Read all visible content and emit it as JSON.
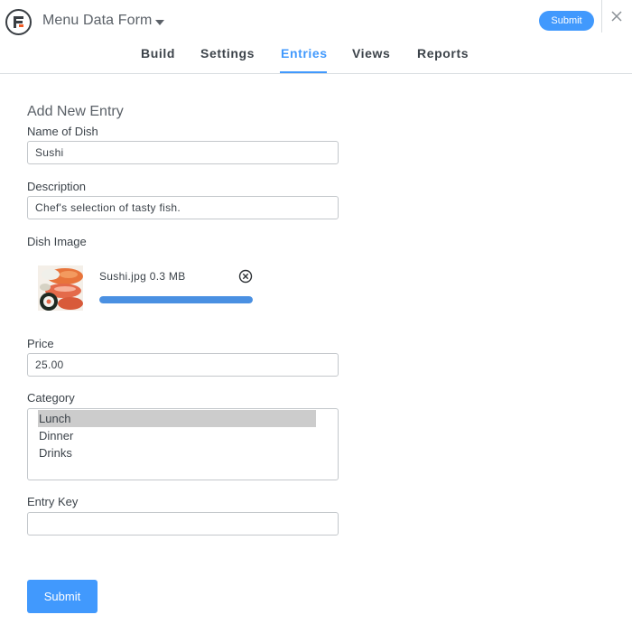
{
  "header": {
    "form_title": "Menu Data Form",
    "submit_label": "Submit",
    "tabs": [
      {
        "label": "Build"
      },
      {
        "label": "Settings"
      },
      {
        "label": "Entries"
      },
      {
        "label": "Views"
      },
      {
        "label": "Reports"
      }
    ],
    "active_tab": "Entries"
  },
  "form": {
    "section_title": "Add New Entry",
    "name": {
      "label": "Name of Dish",
      "value": "Sushi"
    },
    "description": {
      "label": "Description",
      "value": "Chef's selection of tasty fish."
    },
    "image": {
      "label": "Dish Image",
      "file_name": "Sushi.jpg",
      "file_size": "0.3 MB",
      "upload_progress": 1.0
    },
    "price": {
      "label": "Price",
      "value": "25.00"
    },
    "category": {
      "label": "Category",
      "options": [
        "Lunch",
        "Dinner",
        "Drinks"
      ],
      "selected": "Lunch"
    },
    "entry_key": {
      "label": "Entry Key",
      "value": ""
    },
    "submit_label": "Submit"
  },
  "colors": {
    "accent": "#4199fd",
    "progress": "#4a90e2",
    "selected_option": "#cccccc"
  }
}
